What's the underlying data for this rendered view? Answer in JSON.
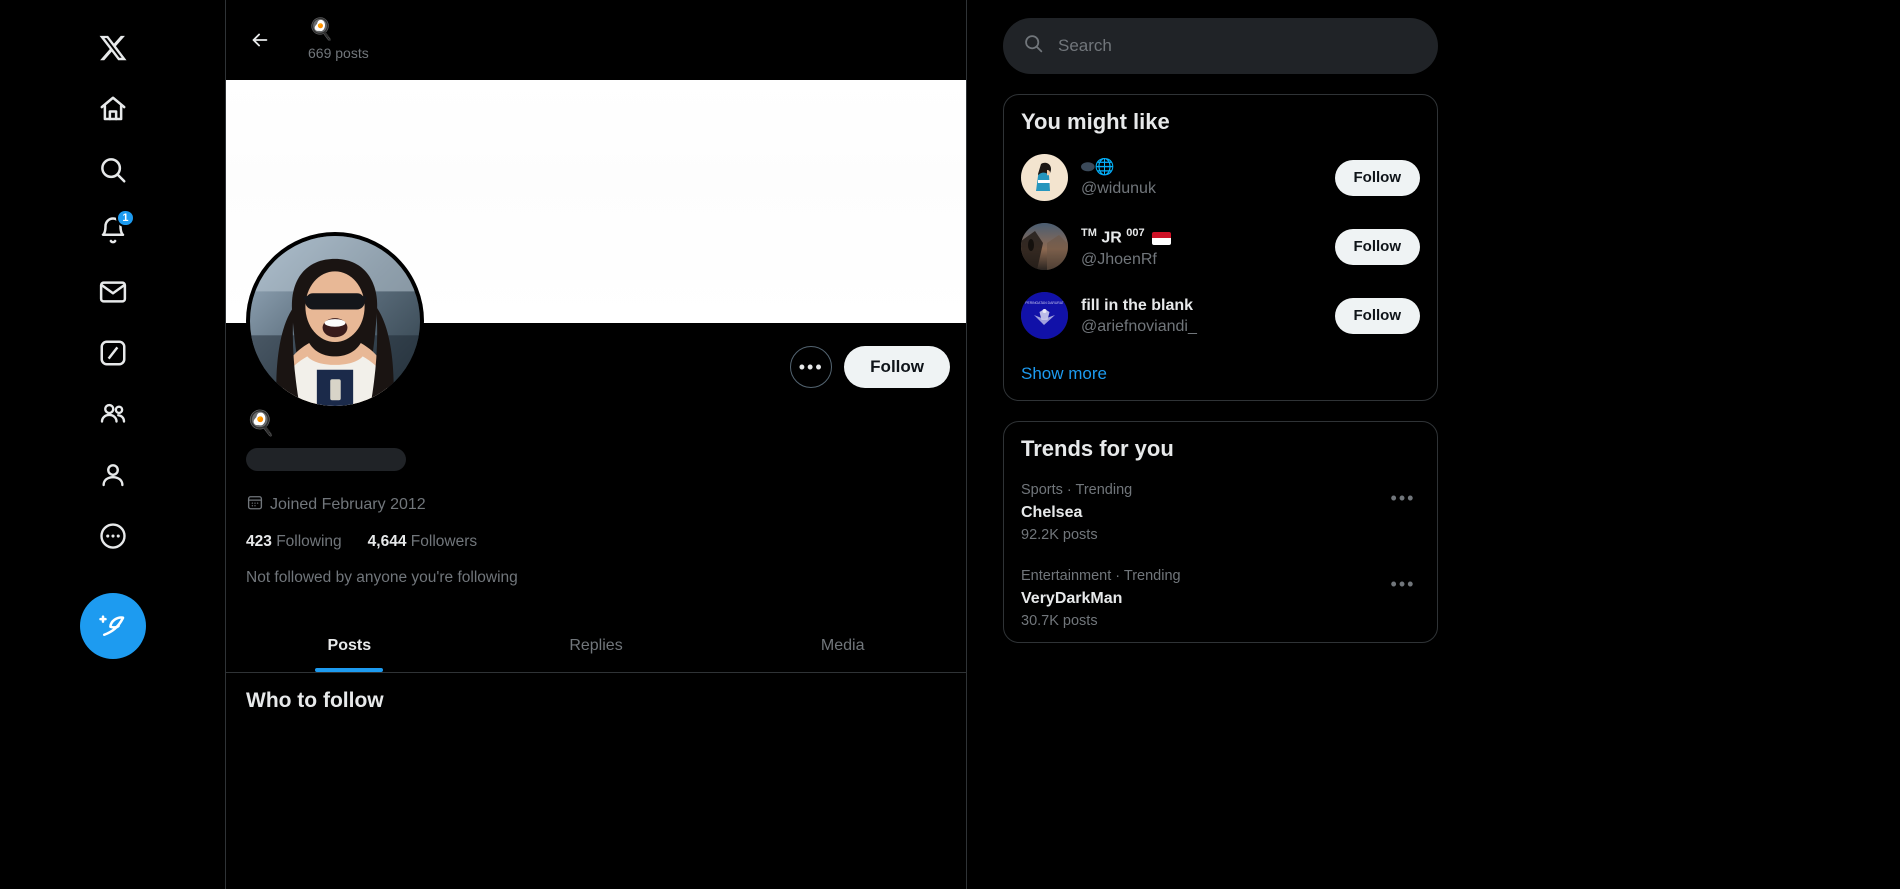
{
  "left_nav": {
    "items": [
      {
        "name": "x-logo",
        "label": "X"
      },
      {
        "name": "home",
        "label": "Home"
      },
      {
        "name": "explore",
        "label": "Search"
      },
      {
        "name": "notifications",
        "label": "Notifications",
        "badge": "1"
      },
      {
        "name": "messages",
        "label": "Messages"
      },
      {
        "name": "grok",
        "label": "Grok"
      },
      {
        "name": "communities",
        "label": "Communities"
      },
      {
        "name": "profile",
        "label": "Profile"
      },
      {
        "name": "more",
        "label": "More"
      }
    ],
    "compose_label": "Post"
  },
  "profile": {
    "header": {
      "back_label": "Back",
      "display_name_emoji": "🍳",
      "post_count": "669 posts"
    },
    "more_button_label": "More",
    "follow_button_label": "Follow",
    "display_name_emoji": "🍳",
    "handle_placeholder": "",
    "joined": "Joined February 2012",
    "following_count": "423",
    "following_label": "Following",
    "followers_count": "4,644",
    "followers_label": "Followers",
    "not_followed_note": "Not followed by anyone you're following",
    "tabs": [
      {
        "label": "Posts",
        "active": true
      },
      {
        "label": "Replies",
        "active": false
      },
      {
        "label": "Media",
        "active": false
      }
    ],
    "who_to_follow_title": "Who to follow"
  },
  "search": {
    "placeholder": "Search"
  },
  "you_might_like": {
    "title": "You might like",
    "accounts": [
      {
        "name": "🛸🌐",
        "handle": "@widunuk",
        "follow_label": "Follow",
        "avatar": "person-looking-up"
      },
      {
        "name": "™ JR ⁰⁰⁷",
        "handle": "@JhoenRf",
        "follow_label": "Follow",
        "avatar": "cliff-silhouette",
        "flag": "id"
      },
      {
        "name": "fill in the blank",
        "handle": "@ariefnoviandi_",
        "follow_label": "Follow",
        "avatar": "garuda-emblem"
      }
    ],
    "show_more": "Show more"
  },
  "trends": {
    "title": "Trends for you",
    "items": [
      {
        "meta": "Sports · Trending",
        "name": "Chelsea",
        "count": "92.2K posts"
      },
      {
        "meta": "Entertainment · Trending",
        "name": "VeryDarkMan",
        "count": "30.7K posts"
      }
    ]
  },
  "colors": {
    "accent": "#1d9bf0",
    "text_primary": "#e7e9ea",
    "text_secondary": "#71767b",
    "border": "#2f3336",
    "button_bg": "#eff3f4"
  }
}
